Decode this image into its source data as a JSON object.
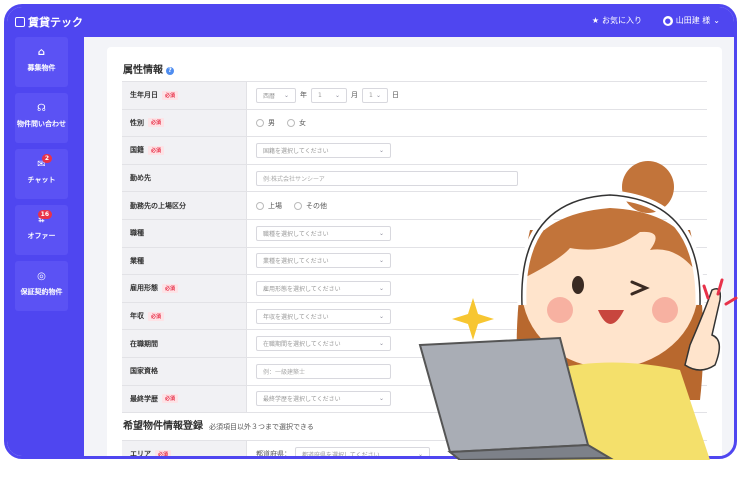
{
  "header": {
    "logo": "賃貸テック",
    "favorites": "お気に入り",
    "user": "山田建 様"
  },
  "sidebar": [
    {
      "label": "募集物件",
      "icon": "home-icon",
      "badge": ""
    },
    {
      "label": "物件問い合わせ",
      "icon": "headset-icon",
      "badge": ""
    },
    {
      "label": "チャット",
      "icon": "chat-icon",
      "badge": "2"
    },
    {
      "label": "オファー",
      "icon": "offer-icon",
      "badge": "16"
    },
    {
      "label": "保証契約物件",
      "icon": "shield-icon",
      "badge": ""
    }
  ],
  "section1": {
    "title": "属性情報",
    "help": "?"
  },
  "required_label": "必須",
  "fields": {
    "birth": {
      "label": "生年月日",
      "era": "西暦",
      "year_unit": "年",
      "month": "1",
      "month_unit": "月",
      "day": "1",
      "day_unit": "日"
    },
    "gender": {
      "label": "性別",
      "male": "男",
      "female": "女"
    },
    "nationality": {
      "label": "国籍",
      "placeholder": "国籍を選択してください"
    },
    "workplace": {
      "label": "勤め先",
      "placeholder": "例:株式会社サンシーア"
    },
    "listing": {
      "label": "勤務先の上場区分",
      "opt1": "上場",
      "opt2": "その他"
    },
    "occupation": {
      "label": "職種",
      "placeholder": "職種を選択してください"
    },
    "industry": {
      "label": "業種",
      "placeholder": "業種を選択してください"
    },
    "employment": {
      "label": "雇用形態",
      "placeholder": "雇用形態を選択してください"
    },
    "income": {
      "label": "年収",
      "placeholder": "年収を選択してください"
    },
    "tenure": {
      "label": "在職期間",
      "placeholder": "在職期間を選択してください"
    },
    "qualification": {
      "label": "国家資格",
      "placeholder": "例：一級建築士"
    },
    "education": {
      "label": "最終学歴",
      "placeholder": "最終学歴を選択してください"
    }
  },
  "section2": {
    "title": "希望物件情報登録",
    "note": "必須項目以外３つまで選択できる"
  },
  "area": {
    "label": "エリア",
    "prefix": "都道府県：",
    "placeholder": "都道府県を選択してください"
  }
}
